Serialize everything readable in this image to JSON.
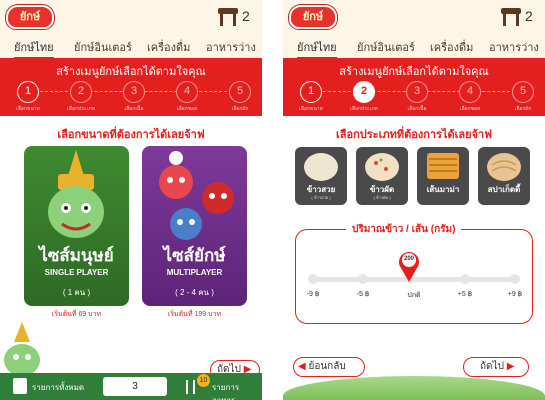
{
  "left": {
    "logo": "ยักษ์",
    "table_number": "2",
    "tabs": [
      "ยักษ์ไทย",
      "ยักษ์อินเตอร์",
      "เครื่องดื่ม",
      "อาหารว่าง"
    ],
    "banner_title": "สร้างเมนูยักษ์เลือกได้ตามใจคุณ",
    "steps": [
      "1",
      "2",
      "3",
      "4",
      "5"
    ],
    "step_labels": [
      "เลือกขนาด",
      "เลือกประเภท",
      "เลือกเนื้อ",
      "เลือกซอส",
      "เลือกผัก"
    ],
    "heading": "เลือกขนาดที่ต้องการได้เลยจ้าฟ",
    "cards": [
      {
        "title": "ไซส์มนุษย์",
        "subtitle": "SINGLE PLAYER",
        "count": "( 1 คน )",
        "price": "เริ่มต้นที่ 69 บาท"
      },
      {
        "title": "ไซส์ยักษ์",
        "subtitle": "MULTIPLAYER",
        "count": "( 2 - 4 คน )",
        "price": "เริ่มต้นที่ 199 บาท"
      }
    ],
    "next_label": "ถัดไป",
    "bottom": {
      "list_label": "รายการทั้งหมด",
      "quantity": "3",
      "badge": "10",
      "food_label": "รายการอาหาร"
    }
  },
  "right": {
    "logo": "ยักษ์",
    "table_number": "2",
    "tabs": [
      "ยักษ์ไทย",
      "ยักษ์อินเตอร์",
      "เครื่องดื่ม",
      "อาหารว่าง"
    ],
    "banner_title": "สร้างเมนูยักษ์เลือกได้ตามใจคุณ",
    "steps": [
      "1",
      "2",
      "3",
      "4",
      "5"
    ],
    "step_labels": [
      "เลือกขนาด",
      "เลือกประเภท",
      "เลือกเนื้อ",
      "เลือกซอส",
      "เลือกผัก"
    ],
    "heading": "เลือกประเภทที่ต้องการได้เลยจ้าฟ",
    "foods": [
      {
        "label": "ข้าวสวย",
        "sub": "( ข้าวสวย )"
      },
      {
        "label": "ข้าวผัด",
        "sub": "( ข้าวผัด )"
      },
      {
        "label": "เส้นมาม่า",
        "sub": ""
      },
      {
        "label": "สปาเก็ตตี้",
        "sub": ""
      }
    ],
    "size_title": "ปริมาณข้าว / เส้น (กรัม)",
    "slider_value": "200",
    "slider_ticks": [
      "-9 ฿",
      "-5 ฿",
      "ปกติ",
      "+5 ฿",
      "+9 ฿"
    ],
    "back_label": "ย้อนกลับ",
    "next_label": "ถัดไป"
  },
  "colors": {
    "brand_red": "#e3201d",
    "green": "#2f7f3a",
    "purple": "#6d2d8a"
  }
}
